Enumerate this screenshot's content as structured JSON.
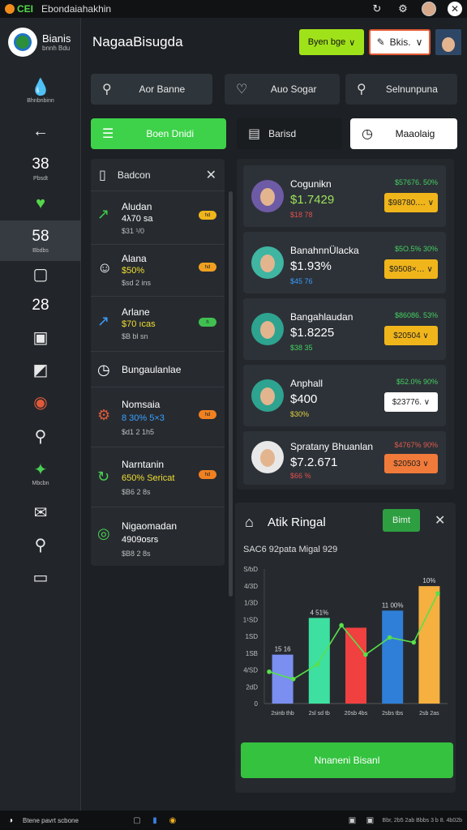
{
  "titlebar": {
    "brand": "CEI",
    "title": "Ebondaiahakhin",
    "icons": [
      "refresh-icon",
      "gear-icon",
      "avatar",
      "close-icon"
    ]
  },
  "sidebar": {
    "brand_name": "Bianis",
    "brand_sub": "bnnh Bdu",
    "items": [
      {
        "icon": "drop-icon",
        "label": "Bhnbnbinn"
      },
      {
        "icon": "arrow-left-icon",
        "label": ""
      },
      {
        "number": "38",
        "label": "Pbsdt"
      },
      {
        "icon": "heart-icon",
        "label": ""
      },
      {
        "number": "58",
        "label": "Bbdbs"
      },
      {
        "icon": "panel-icon",
        "label": ""
      },
      {
        "number": "28",
        "label": ""
      },
      {
        "icon": "panel-icon",
        "label": ""
      },
      {
        "icon": "chart-icon",
        "label": ""
      },
      {
        "icon": "camera-icon",
        "label": ""
      },
      {
        "icon": "search-icon",
        "label": ""
      },
      {
        "icon": "star-icon",
        "label": "Mbcbn"
      },
      {
        "icon": "bag-icon",
        "label": ""
      },
      {
        "icon": "search-icon",
        "label": ""
      },
      {
        "icon": "wallet-icon",
        "label": ""
      }
    ]
  },
  "header": {
    "title": "NagaaBisugda",
    "green_button": "Byen bge",
    "white_button": "Bkis.",
    "chevron": "∨"
  },
  "row1": {
    "search1": "Aor Banne",
    "search2": "Auo Sogar",
    "search3": "Selnunpuna"
  },
  "row2": {
    "green_btn": "Boen Dnidi",
    "dark_btn": "Barisd",
    "white_btn": "Maaolaig"
  },
  "list_panel": {
    "title": "Badcon",
    "items": [
      {
        "name": "Aludan",
        "value": "4λ70 sa",
        "value_color": "#ffffff",
        "sub": "$31 ¹/0",
        "pill_color": "#f0b51b",
        "pill": "hd"
      },
      {
        "name": "Alana",
        "value": "$50%",
        "value_color": "#f2de30",
        "sub": "$sd 2 ins",
        "pill_color": "#f0a020",
        "pill": "hd"
      },
      {
        "name": "Arlane",
        "value": "$70 ıcas",
        "value_color": "#f2de30",
        "sub": "$B bl sn",
        "pill_color": "#40c050",
        "pill": "h"
      },
      {
        "name": "Bungaulanlae",
        "value": "",
        "value_color": "#ffffff",
        "sub": "",
        "pill_color": "",
        "pill": ""
      },
      {
        "name": "Nomsaia",
        "value": "8 30% 5×3",
        "value_color": "#3aa0ff",
        "sub": "$d1 2 1h5",
        "pill_color": "#f08020",
        "pill": "hd"
      },
      {
        "name": "Narntanin",
        "value": "650% Sericat",
        "value_color": "#f2de30",
        "sub": "$B6 2 8s",
        "pill_color": "#f08020",
        "pill": "hd"
      },
      {
        "name": "Nigaomadan",
        "value": "4909osrs",
        "value_color": "#ffffff",
        "sub": "$B8 2 8s",
        "pill_color": "",
        "pill": ""
      }
    ]
  },
  "cards": [
    {
      "name": "Cogunikn",
      "price": "$1.7429",
      "price_color": "#9ee35a",
      "sub": "$18 78",
      "sub_color": "#e05050",
      "pct": "$57676.  50%",
      "pct_color": "#45d060",
      "button": "$98780.… ∨",
      "button_bg": "#f0b51b",
      "avatar_bg": "#6e5ba6"
    },
    {
      "name": "BanahnnÜlacka",
      "price": "$1.93%",
      "price_color": "#ffffff",
      "sub": "$45 76",
      "sub_color": "#3a9cff",
      "pct": "$5O.5% 30%",
      "pct_color": "#45d060",
      "button": "$9508×… ∨",
      "button_bg": "#f0b51b",
      "avatar_bg": "#3fb5a2"
    },
    {
      "name": "Bangahlaudan",
      "price": "$1.8225",
      "price_color": "#ffffff",
      "sub": "$38 35",
      "sub_color": "#45d060",
      "pct": "$86086.  53%",
      "pct_color": "#45d060",
      "button": "$20504 ∨",
      "button_bg": "#f0b51b",
      "avatar_bg": "#2ea38f"
    },
    {
      "name": "Anphall",
      "price": "$400",
      "price_color": "#ffffff",
      "sub": "$30%",
      "sub_color": "#e0d040",
      "pct": "$52.0% 90%",
      "pct_color": "#45d060",
      "button": "$23776. ∨",
      "button_bg": "#ffffff",
      "avatar_bg": "#2ea38f"
    },
    {
      "name": "Spratany Bhuanlan",
      "price": "$7.2.671",
      "price_color": "#ffffff",
      "sub": "$66 %",
      "sub_color": "#e05050",
      "pct": "$4767% 90%",
      "pct_color": "#e05a4a",
      "button": "$20503 ∨",
      "button_bg": "#f07a3a",
      "avatar_bg": "#e8e8e8"
    }
  ],
  "chart_panel": {
    "title": "Atik Ringal",
    "button": "Bimt",
    "subtitle": "SAC6 92pata Migal 929",
    "cta": "Nnaneni Bisanl"
  },
  "chart_data": {
    "type": "bar",
    "categories": [
      "2sinb thb",
      "2sl sd tb",
      "20sb 4bs",
      "2sbs tbs",
      "2sb 2as"
    ],
    "values": [
      20,
      35,
      31,
      38,
      48
    ],
    "bar_labels": [
      "15 16",
      "4 51%",
      "",
      "11 00%",
      "10%"
    ],
    "line_values": [
      13,
      10,
      16,
      32,
      20,
      27,
      25,
      45
    ],
    "y_ticks": [
      "S/bD",
      "4/3D",
      "1/3D",
      "1¹SD",
      "1SD",
      "1SB",
      "4/SD",
      "2dD",
      "0"
    ],
    "colors": [
      "#7a8ff0",
      "#3de0a0",
      "#f04040",
      "#2f7fd8",
      "#f5b040"
    ]
  },
  "taskbar": {
    "search": "Btene pavrt scbone",
    "right_text": "Bbr, 2b5 2ab Bbbs\n3 b 8. 4b02b"
  }
}
